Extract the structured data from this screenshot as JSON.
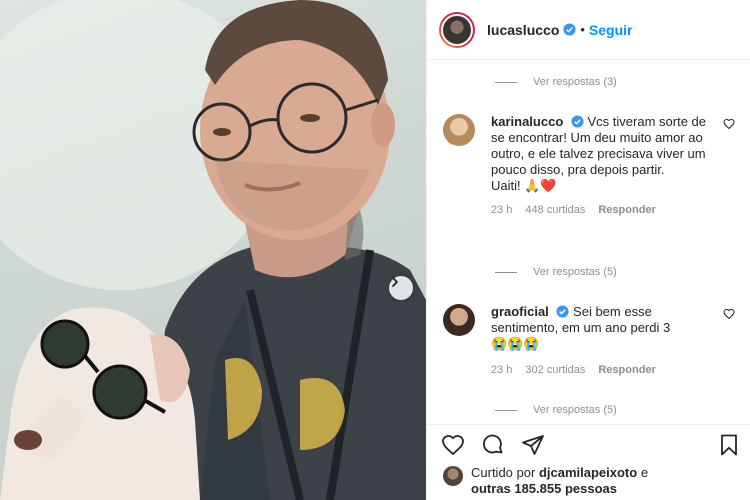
{
  "post": {
    "username": "lucaslucco",
    "separator": "•",
    "follow_label": "Seguir"
  },
  "thread": {
    "replies_1": "Ver respostas (3)",
    "replies_2": "Ver respostas (5)",
    "replies_3": "Ver respostas (5)"
  },
  "comments": [
    {
      "username": "karinalucco",
      "text": "Vcs tiveram sorte de se encontrar! Um deu muito amor ao outro, e ele talvez precisava viver um pouco disso, pra depois partir.",
      "text2": "Uaiti!",
      "emoji": "🙏❤️",
      "time": "23 h",
      "likes": "448 curtidas",
      "reply_label": "Responder"
    },
    {
      "username": "graoficial",
      "text": "Sei bem esse sentimento, em um ano perdi 3",
      "emoji": "😭😭😭",
      "time": "23 h",
      "likes": "302 curtidas",
      "reply_label": "Responder"
    }
  ],
  "liked_by": {
    "prefix": "Curtido por",
    "user": "djcamilapeixoto",
    "connector": "e",
    "others": "outras 185.855 pessoas"
  },
  "colors": {
    "link_blue": "#0095f6",
    "muted_gray": "#8e8e8e",
    "text": "#262626",
    "heart_red": "#ed4956"
  },
  "icons": [
    "chevron-right-icon",
    "verified-badge-icon",
    "heart-icon",
    "comment-icon",
    "share-icon",
    "bookmark-icon"
  ]
}
